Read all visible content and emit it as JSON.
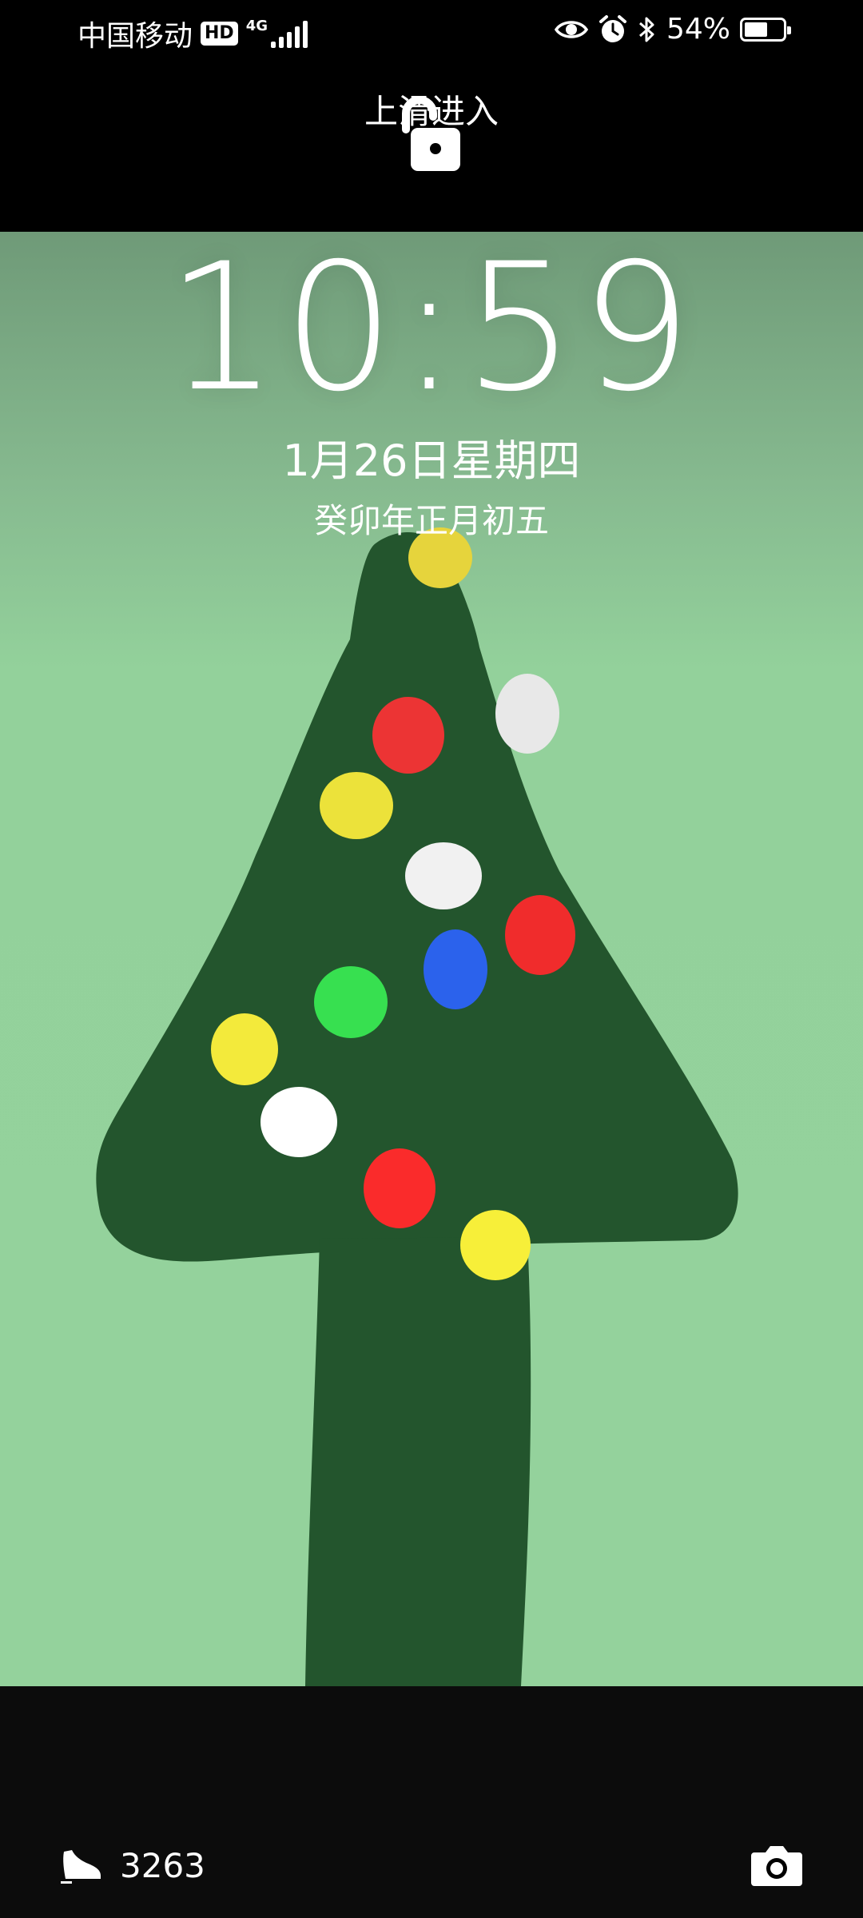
{
  "status_bar": {
    "carrier": "中国移动",
    "hd_badge": "HD",
    "network": "4G",
    "battery_percent": "54%",
    "icons": [
      "eye-icon",
      "alarm-icon",
      "bluetooth-icon",
      "battery-eco-icon"
    ]
  },
  "unlock": {
    "label": "上滑进入",
    "icon": "unlock-icon"
  },
  "clock": {
    "time": "10:59",
    "date": "1月26日星期四",
    "lunar_date": "癸卯年正月初五"
  },
  "bottom": {
    "step_count": "3263",
    "step_icon": "shoe-icon",
    "camera_icon": "camera-icon"
  },
  "wallpaper": {
    "background_color": "#94d29c",
    "tree_color": "#23552d",
    "ornament_colors": [
      "#f0dc3a",
      "#e8e8e8",
      "#ec3434",
      "#2a63ef",
      "#36e051",
      "#ffffff",
      "#f6ef3a"
    ]
  }
}
